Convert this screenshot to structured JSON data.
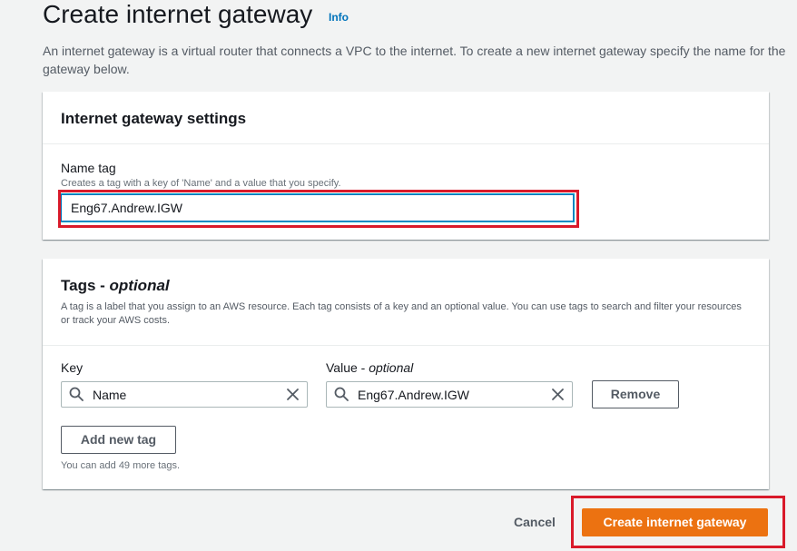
{
  "page": {
    "title": "Create internet gateway",
    "info_link": "Info",
    "description": "An internet gateway is a virtual router that connects a VPC to the internet. To create a new internet gateway specify the name for the gateway below."
  },
  "settings": {
    "title": "Internet gateway settings",
    "name_tag_label": "Name tag",
    "name_tag_hint": "Creates a tag with a key of 'Name' and a value that you specify.",
    "name_tag_value": "Eng67.Andrew.IGW"
  },
  "tags": {
    "title": "Tags - ",
    "title_optional": "optional",
    "description": "A tag is a label that you assign to an AWS resource. Each tag consists of a key and an optional value. You can use tags to search and filter your resources or track your AWS costs.",
    "key_label": "Key",
    "value_label": "Value - ",
    "value_label_optional": "optional",
    "rows": [
      {
        "key": "Name",
        "value": "Eng67.Andrew.IGW",
        "remove_label": "Remove"
      }
    ],
    "add_button": "Add new tag",
    "remaining_text": "You can add 49 more tags."
  },
  "footer": {
    "cancel": "Cancel",
    "submit": "Create internet gateway"
  },
  "colors": {
    "primary": "#ec7211",
    "link": "#0073bb",
    "highlight": "#d91a2a"
  }
}
